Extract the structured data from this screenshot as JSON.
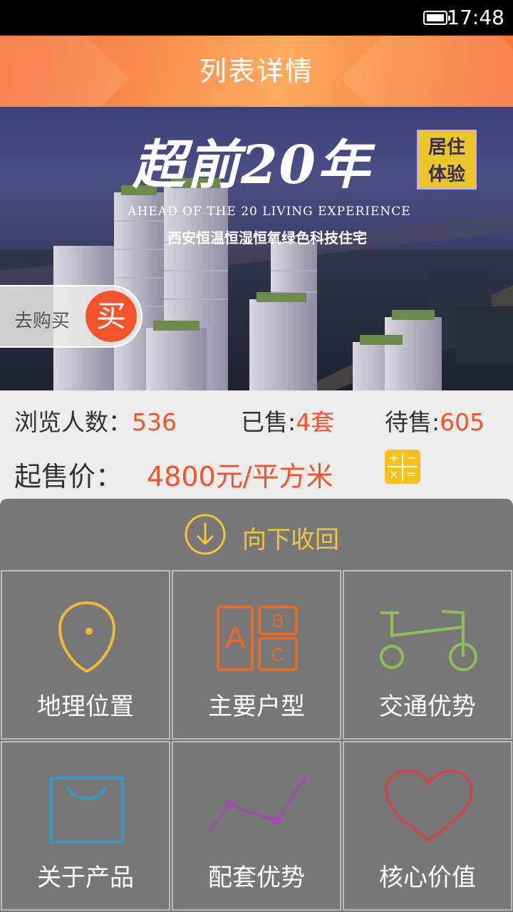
{
  "status_bar": {
    "time": "17:48"
  },
  "header": {
    "title": "列表详情"
  },
  "banner": {
    "headline": "超前20年",
    "badge_line1": "居住",
    "badge_line2": "体验",
    "subtitle_en": "AHEAD OF THE 20 LIVING EXPERIENCE",
    "subtitle_cn": "西安恒温恒湿恒氧绿色科技住宅",
    "buy_text": "去购买",
    "buy_button": "买"
  },
  "stats": {
    "views_label": "浏览人数：",
    "views_value": "536",
    "sold_label": "已售:",
    "sold_value": "4套",
    "pending_label": "待售:",
    "pending_value": "605"
  },
  "price": {
    "label": "起售价：",
    "value": "4800元/平方米"
  },
  "panel": {
    "collapse_label": "向下收回",
    "tiles": [
      {
        "label": "地理位置",
        "icon": "location-icon"
      },
      {
        "label": "主要户型",
        "icon": "abc-blocks-icon"
      },
      {
        "label": "交通优势",
        "icon": "bicycle-icon"
      },
      {
        "label": "关于产品",
        "icon": "shopping-bag-icon"
      },
      {
        "label": "配套优势",
        "icon": "line-chart-icon"
      },
      {
        "label": "核心价值",
        "icon": "heart-icon"
      }
    ]
  },
  "colors": {
    "accent": "#f3532a",
    "header_orange": "#f98e4f",
    "panel_gray": "#777777",
    "collapse_yellow": "#f4c536"
  }
}
